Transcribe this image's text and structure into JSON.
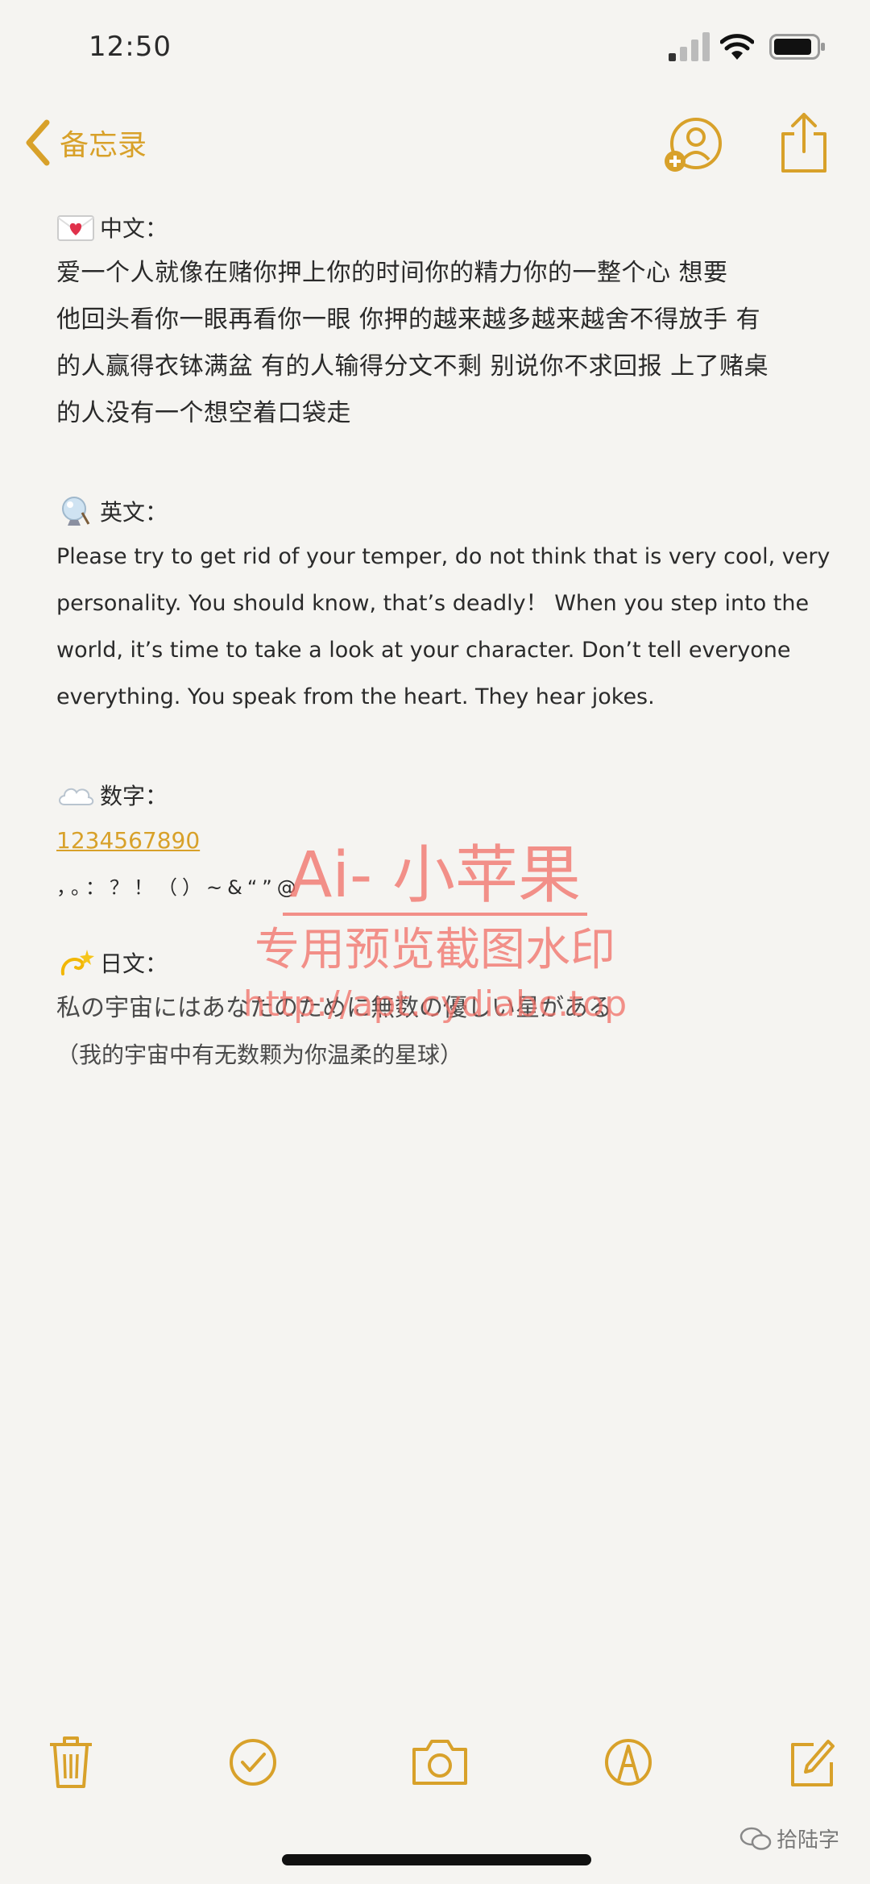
{
  "status": {
    "time": "12:50"
  },
  "nav": {
    "back_label": "备忘录"
  },
  "note": {
    "chinese": {
      "heading": "中文：",
      "lines": [
        "爱一个人就像在赌你押上你的时间你的精力你的一整个心 想要",
        "他回头看你一眼再看你一眼 你押的越来越多越来越舍不得放手 有",
        "的人赢得衣钵满盆 有的人输得分文不剩 别说你不求回报 上了赌桌",
        "的人没有一个想空着口袋走"
      ]
    },
    "english": {
      "heading": "英文：",
      "lines": [
        "Please try to get rid of your temper, do not think that is very cool, very",
        "personality. You should know, that’s deadly！ When you step into the",
        "world, it’s time to take a look at your character. Don’t tell everyone",
        "everything. You speak from the heart. They hear jokes."
      ]
    },
    "numbers": {
      "heading": "数字：",
      "digits": "1234567890",
      "punctuation": "，。：？！（）~&“”@"
    },
    "japanese": {
      "heading": "日文：",
      "line": "私の宇宙にはあなたのために無数の優しい星がある",
      "translation": "（我的宇宙中有无数颗为你温柔的星球）"
    }
  },
  "watermark": {
    "title": "Ai- 小苹果",
    "subtitle": "专用预览截图水印",
    "url": "http://apt.cydiabc.top"
  },
  "wechat": {
    "label": "拾陆字"
  },
  "colors": {
    "accent": "#d8a12a",
    "watermark": "#f06e64",
    "background": "#f5f4f1"
  },
  "icons": {
    "back": "chevron-left-icon",
    "collaborate": "add-person-icon",
    "share": "share-icon",
    "toolbar": [
      "trash-icon",
      "checklist-icon",
      "camera-icon",
      "markup-icon",
      "compose-icon"
    ]
  }
}
